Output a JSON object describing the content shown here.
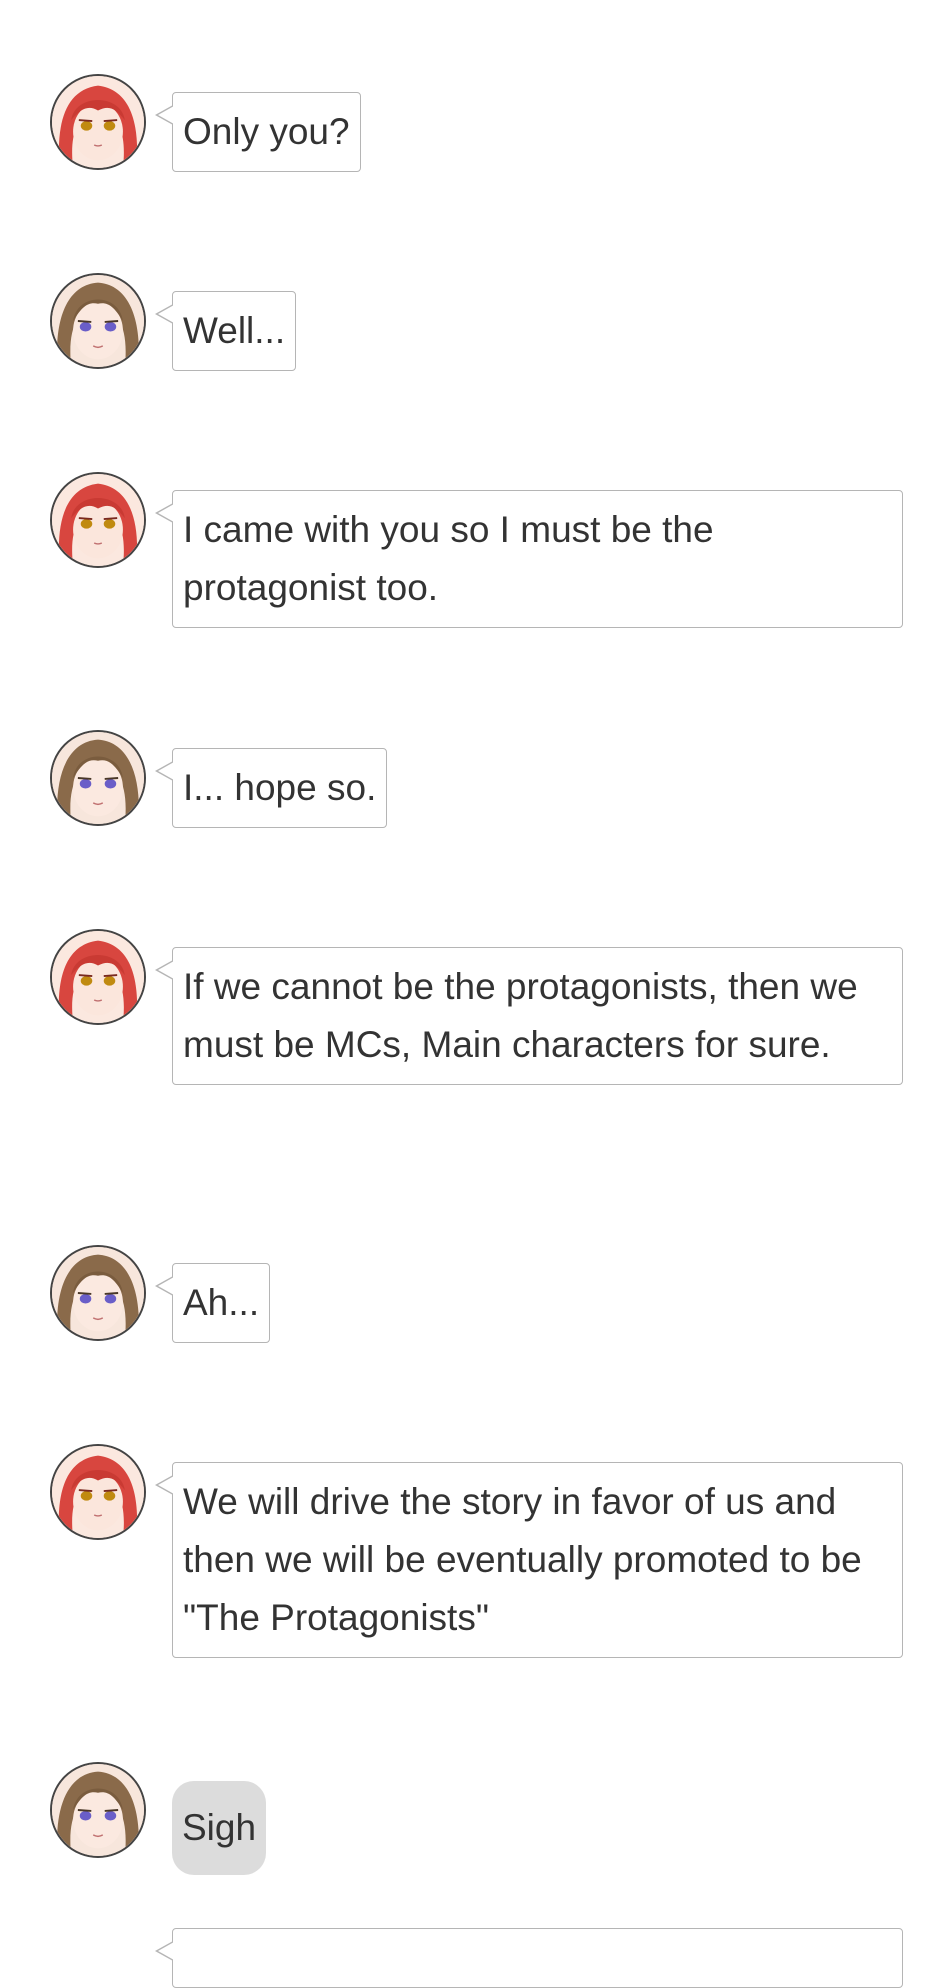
{
  "characters": {
    "redhead": {
      "name": "red-haired-girl",
      "hair": "#d8463f",
      "hair_dark": "#a8281f",
      "eyes": "#c08a10"
    },
    "brunette": {
      "name": "brown-haired-girl",
      "hair": "#8a6a4a",
      "hair_dark": "#5e4530",
      "eyes": "#6a5ec8"
    }
  },
  "messages": [
    {
      "speaker": "redhead",
      "text": "Only you?",
      "style": "speech"
    },
    {
      "speaker": "brunette",
      "text": "Well...",
      "style": "speech"
    },
    {
      "speaker": "redhead",
      "text": "I came with you so I must be the protagonist too.",
      "style": "speech"
    },
    {
      "speaker": "brunette",
      "text": "I... hope so.",
      "style": "speech"
    },
    {
      "speaker": "redhead",
      "text": "If we cannot be the protagonists, then we must be MCs, Main characters for sure.",
      "style": "speech"
    },
    {
      "speaker": "brunette",
      "text": "Ah...",
      "style": "speech"
    },
    {
      "speaker": "redhead",
      "text": "We will drive the story in favor of us and then we will be eventually promoted to be \"The Protagonists\"",
      "style": "speech"
    },
    {
      "speaker": "brunette",
      "text": "Sigh",
      "style": "thought"
    },
    {
      "speaker": "redhead",
      "text": "",
      "style": "speech"
    }
  ]
}
